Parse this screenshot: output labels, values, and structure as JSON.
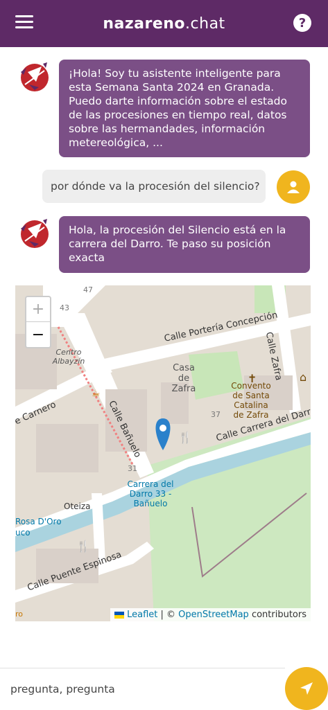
{
  "header": {
    "title_bold": "nazareno",
    "title_light": ".chat",
    "help_symbol": "?"
  },
  "messages": [
    {
      "role": "bot",
      "text": "¡Hola! Soy tu asistente inteligente para esta Semana Santa 2024 en Granada. Puedo darte información sobre el estado de las procesiones en tiempo real, datos sobre las hermandades, información metereológica, ..."
    },
    {
      "role": "user",
      "text": "por dónde va la procesión del silencio?"
    },
    {
      "role": "bot",
      "text": "Hola, la procesión del Silencio está en la carrera del Darro. Te paso su posición exacta"
    }
  ],
  "map": {
    "zoom_in": "+",
    "zoom_out": "−",
    "labels": {
      "calle_porteria": "Calle Portería Concepción",
      "calle_zafra": "Calle Zafra",
      "casa_zafra": "Casa de Zafra",
      "convento": "Convento de Santa Catalina de Zafra",
      "centro": "Centro Albayzín",
      "carnero": "e Carnero",
      "banuelo": "Calle Bañuelo",
      "carrera": "Calle Carrera del Darro",
      "parada": "Carrera del Darro 33 - Bañuelo",
      "oteiza": "Oteiza",
      "rosa": "Rosa D'Oro",
      "uco": "uco",
      "espinosa": "Calle Puente Espinosa",
      "num47": "47",
      "num43": "43",
      "num37": "37",
      "num31": "31",
      "ro": "ro"
    },
    "attribution": {
      "leaflet": "Leaflet",
      "sep": " | © ",
      "osm": "OpenStreetMap",
      "contrib": " contributors"
    }
  },
  "input": {
    "placeholder": "pregunta, pregunta"
  },
  "colors": {
    "brand": "#5e2a66",
    "bot_bubble": "#7b4f86",
    "accent": "#f0b51e"
  }
}
